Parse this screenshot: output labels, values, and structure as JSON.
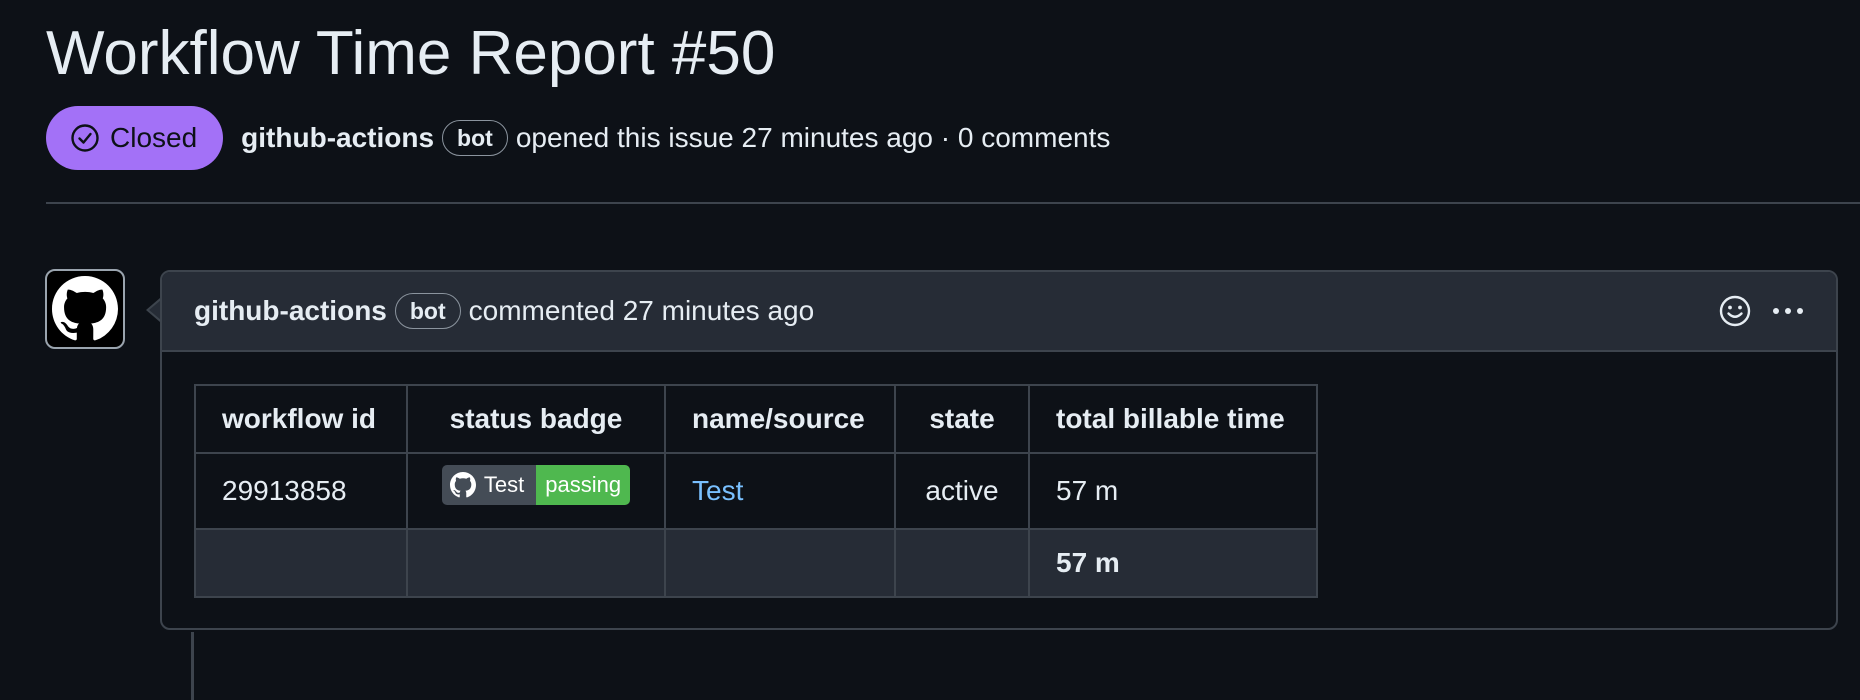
{
  "issue": {
    "title": "Workflow Time Report #50",
    "state_label": "Closed",
    "author": "github-actions",
    "author_badge": "bot",
    "opened_text": "opened this issue 27 minutes ago · 0 comments"
  },
  "comment": {
    "author": "github-actions",
    "author_badge": "bot",
    "meta_text": "commented 27 minutes ago",
    "actions": [
      "smiley-icon",
      "kebab-horizontal-icon"
    ]
  },
  "report_table": {
    "headers": [
      "workflow id",
      "status badge",
      "name/source",
      "state",
      "total billable time"
    ],
    "rows": [
      {
        "workflow_id": "29913858",
        "badge_label": "Test",
        "badge_status": "passing",
        "name_source": "Test",
        "state": "active",
        "total_billable_time": "57 m"
      }
    ],
    "totals": {
      "total_billable_time": "57 m"
    }
  },
  "colors": {
    "background": "#0d1117",
    "closed_pill": "#a371f7",
    "border": "#3d444d",
    "header_bg": "#262c36",
    "link": "#79c0ff",
    "badge_passing": "#4fb84f",
    "badge_label_bg": "#444c56"
  }
}
